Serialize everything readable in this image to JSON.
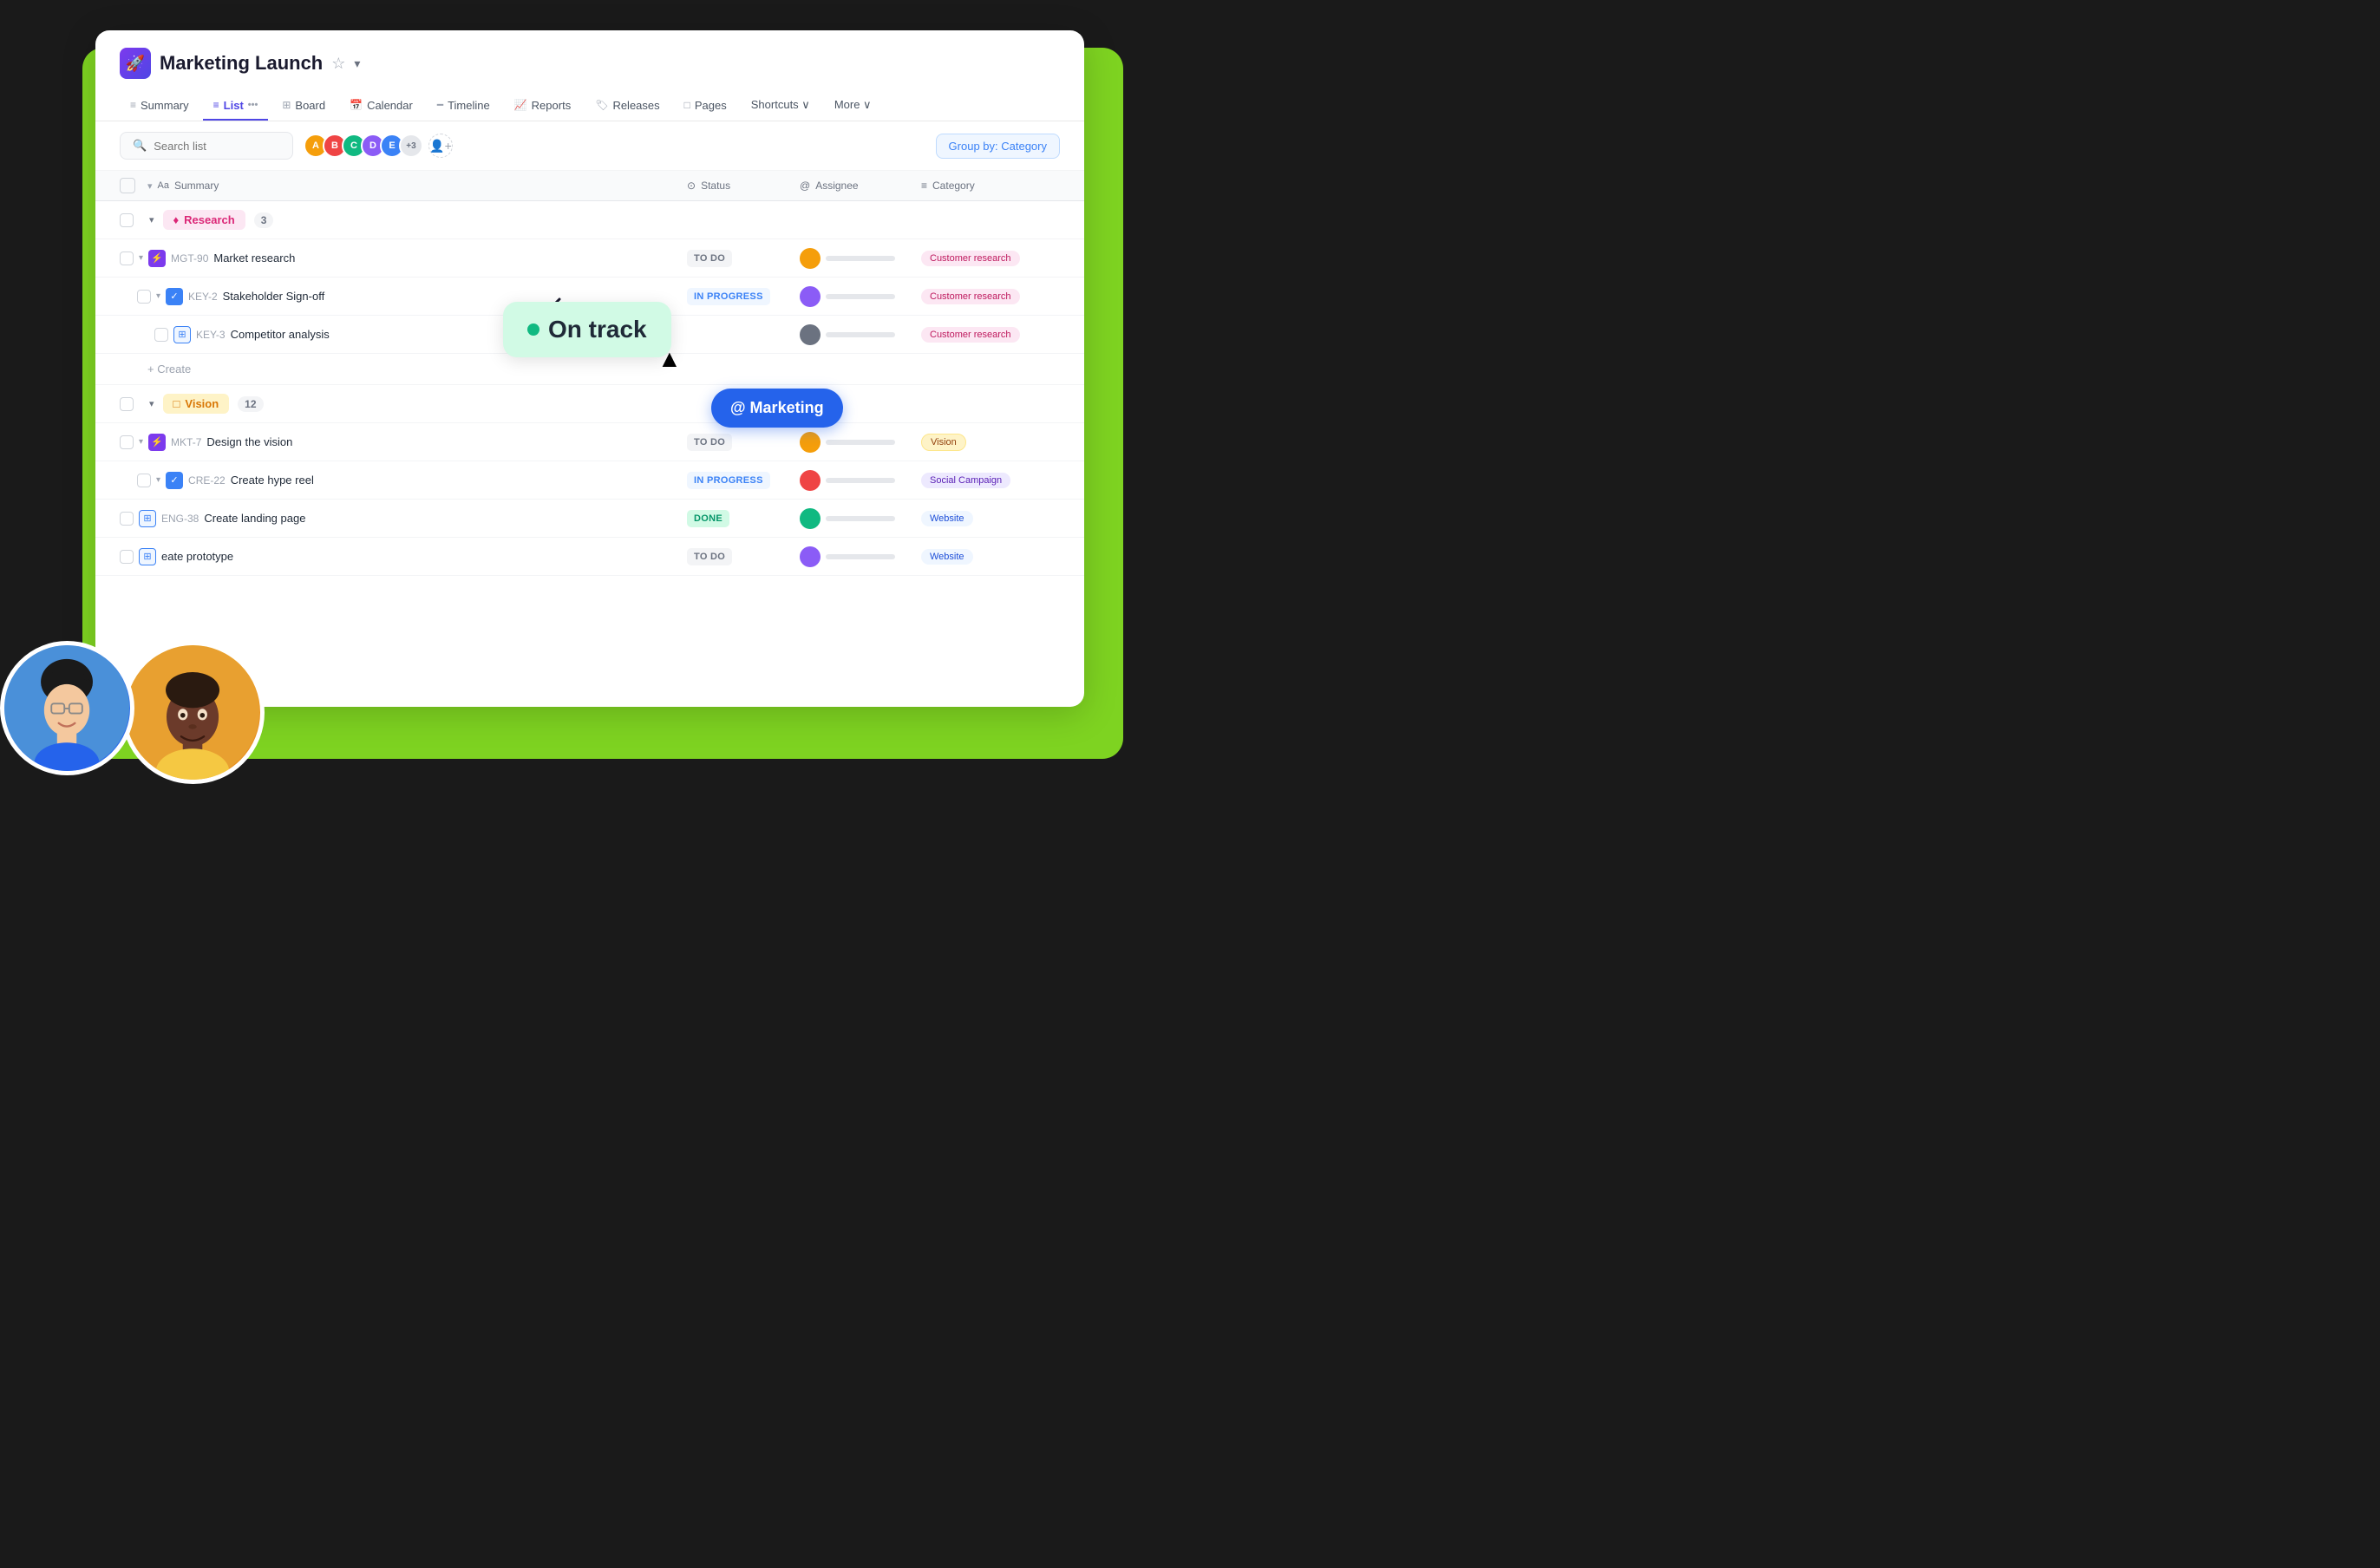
{
  "app": {
    "icon": "🚀",
    "title": "Marketing Launch",
    "star": "☆",
    "chevron": "▾"
  },
  "nav": {
    "tabs": [
      {
        "id": "summary",
        "label": "Summary",
        "icon": "≡",
        "active": false
      },
      {
        "id": "list",
        "label": "List",
        "icon": "≡",
        "active": true
      },
      {
        "id": "board",
        "label": "Board",
        "icon": "⊞",
        "active": false
      },
      {
        "id": "calendar",
        "label": "Calendar",
        "icon": "📅",
        "active": false
      },
      {
        "id": "timeline",
        "label": "Timeline",
        "icon": "━",
        "active": false
      },
      {
        "id": "reports",
        "label": "Reports",
        "icon": "📈",
        "active": false
      },
      {
        "id": "releases",
        "label": "Releases",
        "icon": "🚀",
        "active": false
      },
      {
        "id": "pages",
        "label": "Pages",
        "icon": "□",
        "active": false
      },
      {
        "id": "shortcuts",
        "label": "Shortcuts ∨",
        "icon": "",
        "active": false
      },
      {
        "id": "more",
        "label": "More ∨",
        "icon": "",
        "active": false
      }
    ]
  },
  "toolbar": {
    "search_placeholder": "Search list",
    "group_by_label": "Group by: Category",
    "avatars": [
      {
        "bg": "#f59e0b",
        "label": "A1"
      },
      {
        "bg": "#ef4444",
        "label": "A2"
      },
      {
        "bg": "#10b981",
        "label": "A3"
      },
      {
        "bg": "#8b5cf6",
        "label": "A4"
      },
      {
        "bg": "#3b82f6",
        "label": "A5"
      }
    ],
    "avatar_extra": "+3"
  },
  "table": {
    "headers": [
      "Summary",
      "Status",
      "Assignee",
      "Category"
    ],
    "groups": [
      {
        "id": "research",
        "label": "Research",
        "icon": "♦",
        "color": "research",
        "count": "3",
        "tasks": [
          {
            "id": "MGT-90",
            "name": "Market research",
            "icon_type": "purple",
            "icon": "⚡",
            "status": "TO DO",
            "status_class": "todo",
            "assignee_bg": "#f59e0b",
            "category": "Customer research",
            "category_class": "customer-research",
            "indent": 1
          },
          {
            "id": "KEY-2",
            "name": "Stakeholder Sign-off",
            "icon_type": "blue",
            "icon": "✓",
            "status": "IN PROGRESS",
            "status_class": "in-progress",
            "assignee_bg": "#8b5cf6",
            "category": "Customer research",
            "category_class": "customer-research",
            "indent": 1
          },
          {
            "id": "KEY-3",
            "name": "Competitor analysis",
            "icon_type": "blue-outline",
            "icon": "⊞",
            "status": "",
            "status_class": "",
            "assignee_bg": "#6b7280",
            "category": "Customer research",
            "category_class": "customer-research",
            "indent": 2
          }
        ]
      },
      {
        "id": "vision",
        "label": "Vision",
        "icon": "□",
        "color": "vision",
        "count": "12",
        "tasks": [
          {
            "id": "MKT-7",
            "name": "Design the vision",
            "icon_type": "purple",
            "icon": "⚡",
            "status": "TO DO",
            "status_class": "todo",
            "assignee_bg": "#f59e0b",
            "category": "Vision",
            "category_class": "vision-cat",
            "indent": 1
          },
          {
            "id": "CRE-22",
            "name": "Create hype reel",
            "icon_type": "blue",
            "icon": "✓",
            "status": "IN PROGRESS",
            "status_class": "in-progress",
            "assignee_bg": "#ef4444",
            "category": "Social Campaign",
            "category_class": "social",
            "indent": 1
          },
          {
            "id": "ENG-38",
            "name": "Create landing page",
            "icon_type": "blue-outline",
            "icon": "⊞",
            "status": "DONE",
            "status_class": "done",
            "assignee_bg": "#10b981",
            "category": "Website",
            "category_class": "website",
            "indent": 1
          },
          {
            "id": "",
            "name": "eate prototype",
            "icon_type": "blue-outline",
            "icon": "⊞",
            "status": "TO DO",
            "status_class": "todo",
            "assignee_bg": "#8b5cf6",
            "category": "Website",
            "category_class": "website",
            "indent": 1
          }
        ]
      }
    ]
  },
  "tooltips": {
    "on_track": "On track",
    "marketing": "@ Marketing"
  },
  "create_label": "+ Create"
}
